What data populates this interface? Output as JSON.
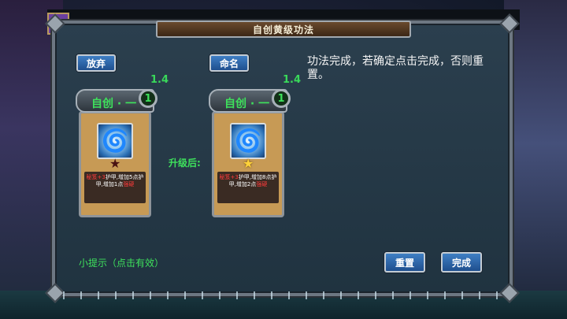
{
  "dialog": {
    "title": "自创黄级功法",
    "giveup_label": "放弃",
    "rename_label": "命名",
    "message": "功法完成，若确定点击完成，否则重置。",
    "upgrade_label": "升级后:",
    "hint": "小提示（点击有效）",
    "reset_label": "重置",
    "done_label": "完成"
  },
  "cards": [
    {
      "version": "1.4",
      "name": "自创 · 一",
      "level": "1",
      "star": "dark",
      "desc_red_1": "秘笈+3",
      "desc_white_1": "护甲,增加5点护甲,增加1点",
      "desc_red_2": "强硬"
    },
    {
      "version": "1.4",
      "name": "自创 · 一",
      "level": "1",
      "star": "gold",
      "desc_red_1": "秘笈+3",
      "desc_white_1": "护甲,增加8点护甲,增加2点",
      "desc_red_2": "强硬"
    }
  ],
  "colors": {
    "accent_green": "#3ee15c",
    "button_blue": "#2f67a8",
    "card_tan": "#c79a55"
  }
}
